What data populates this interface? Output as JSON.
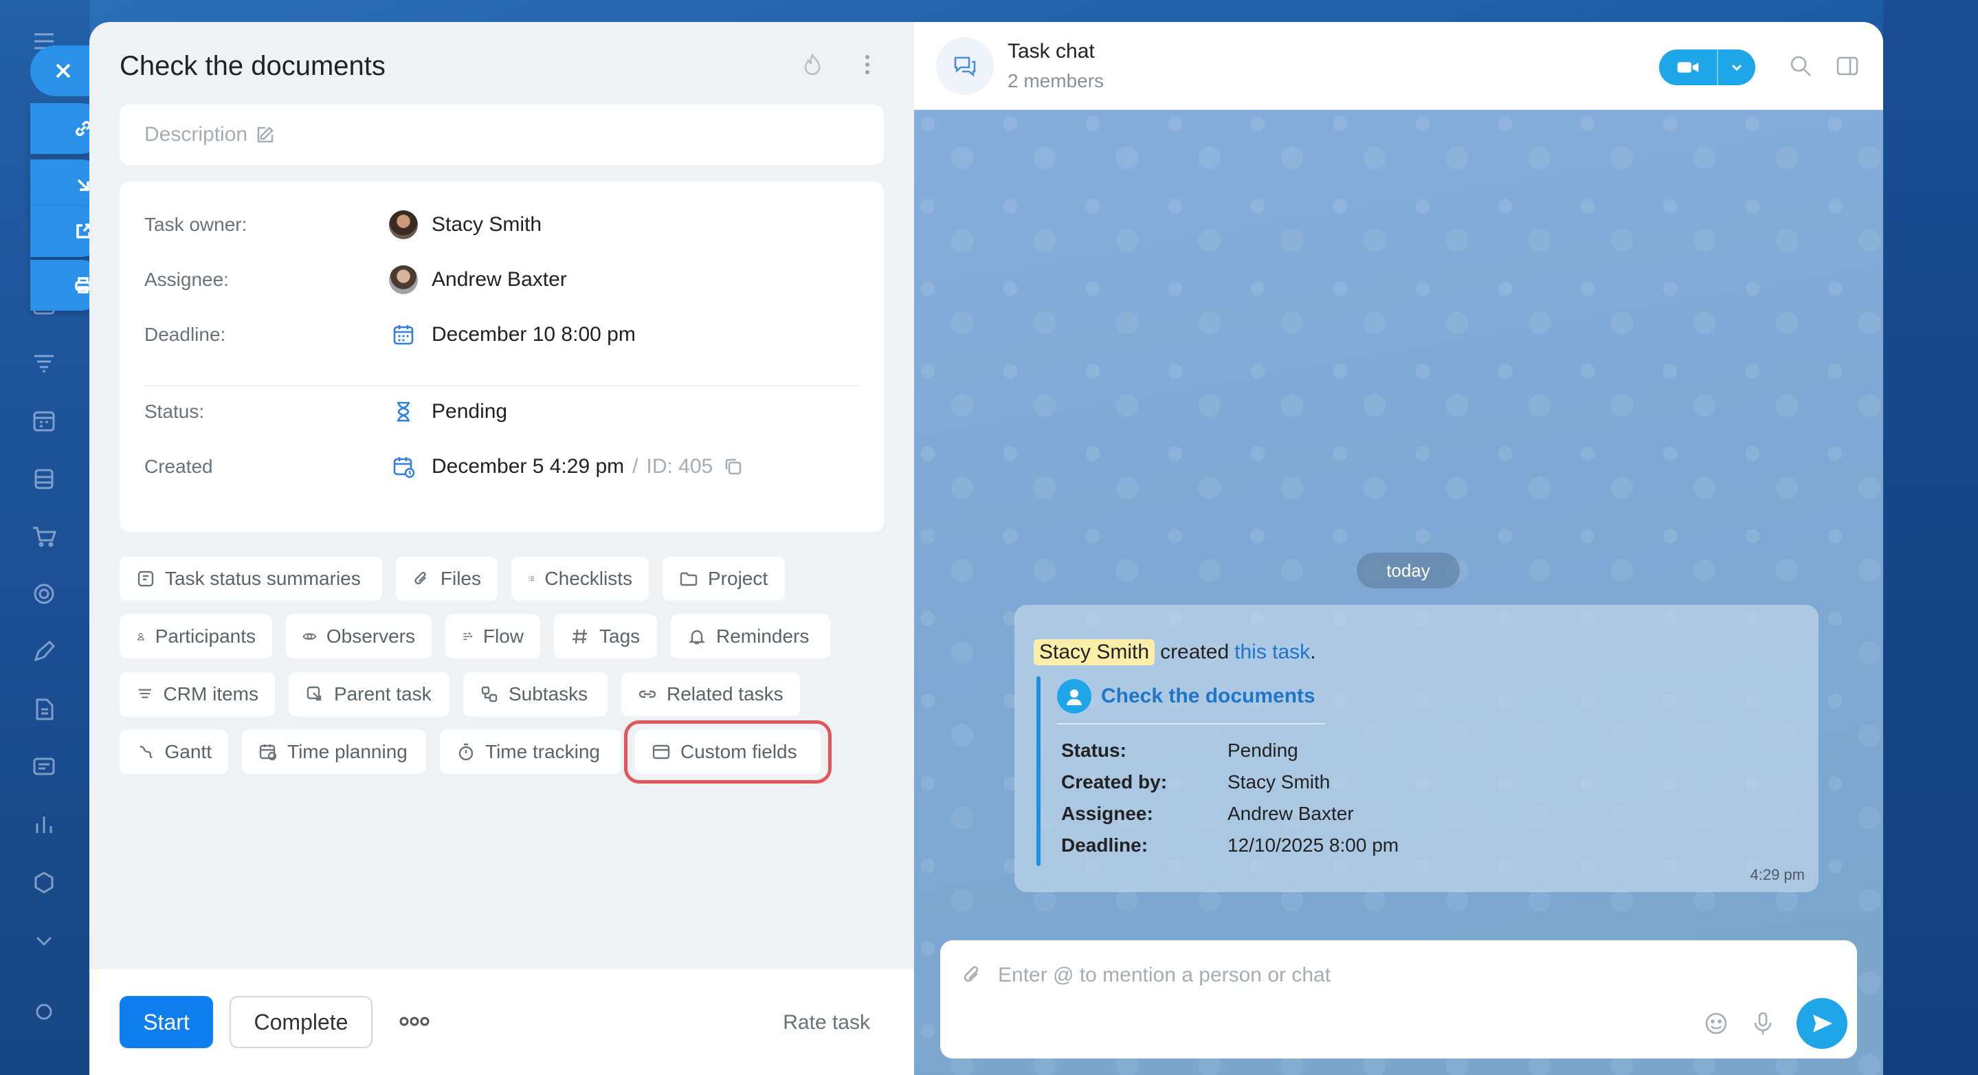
{
  "task": {
    "title": "Check the documents",
    "description_placeholder": "Description",
    "fields": {
      "owner_label": "Task owner:",
      "owner_value": "Stacy Smith",
      "assignee_label": "Assignee:",
      "assignee_value": "Andrew Baxter",
      "deadline_label": "Deadline:",
      "deadline_value": "December 10 8:00 pm",
      "status_label": "Status:",
      "status_value": "Pending",
      "created_label": "Created",
      "created_value": "December 5 4:29 pm",
      "id_separator": "/",
      "id_value": "ID: 405"
    },
    "chips": [
      "Task status summaries",
      "Files",
      "Checklists",
      "Project",
      "Participants",
      "Observers",
      "Flow",
      "Tags",
      "Reminders",
      "CRM items",
      "Parent task",
      "Subtasks",
      "Related tasks",
      "Gantt",
      "Time planning",
      "Time tracking",
      "Custom fields"
    ],
    "highlighted_chip": "Custom fields",
    "footer": {
      "start_label": "Start",
      "complete_label": "Complete",
      "rate_label": "Rate task"
    }
  },
  "chat": {
    "title": "Task chat",
    "subtitle": "2 members",
    "date_divider": "today",
    "message": {
      "author": "Stacy Smith",
      "text": "created",
      "link_text": "this task",
      "punct": ".",
      "quote_title": "Check the documents",
      "rows": [
        {
          "key": "Status:",
          "value": "Pending"
        },
        {
          "key": "Created by:",
          "value": "Stacy Smith"
        },
        {
          "key": "Assignee:",
          "value": "Andrew Baxter"
        },
        {
          "key": "Deadline:",
          "value": "12/10/2025 8:00 pm"
        }
      ],
      "time": "4:29 pm"
    },
    "composer_placeholder": "Enter @ to mention a person or chat"
  },
  "colors": {
    "accent": "#0f7ef0",
    "chat_accent": "#1ea6e8",
    "highlight_ring": "#e1575a"
  }
}
